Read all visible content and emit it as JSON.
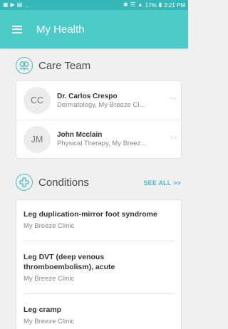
{
  "status_bar": {
    "left_icons": [
      "gallery-icon",
      "play-icon",
      "image-icon"
    ],
    "left_ellipsis": "...",
    "right_status": "✱ 📶 17% ⏳ 2:21 PM",
    "battery": "17%",
    "time": "2:21 PM"
  },
  "app_bar": {
    "title": "My Health"
  },
  "care_team": {
    "title": "Care Team",
    "members": [
      {
        "initials": "CC",
        "name": "Dr. Carlos Crespo",
        "subtitle": "Dermatology, My Breeze Cl...",
        "chevron": ">>"
      },
      {
        "initials": "JM",
        "name": "John Mcclain",
        "subtitle": "Physical Therapy, My Breez...",
        "chevron": ">>"
      }
    ]
  },
  "conditions": {
    "title": "Conditions",
    "see_all": "SEE ALL >>",
    "items": [
      {
        "title": "Leg duplication-mirror foot syndrome",
        "subtitle": "My Breeze Clinic"
      },
      {
        "title": "Leg DVT (deep venous thromboembolism), acute",
        "subtitle": "My Breeze Clinic"
      },
      {
        "title": "Leg cramp",
        "subtitle": "My Breeze Clinic"
      }
    ]
  },
  "colors": {
    "accent": "#4dcbc9",
    "status_bar": "#37b8b8",
    "link": "#46bcc0"
  }
}
